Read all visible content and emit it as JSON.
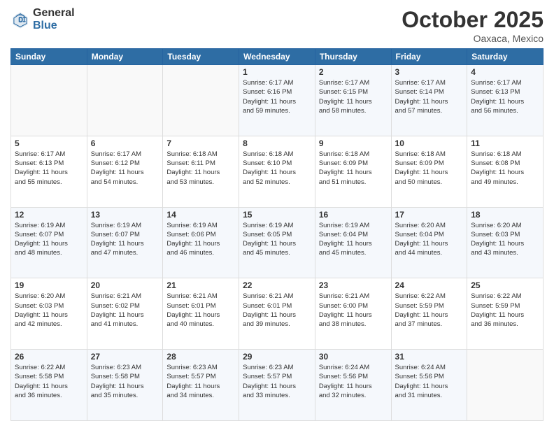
{
  "logo": {
    "general": "General",
    "blue": "Blue"
  },
  "title": "October 2025",
  "location": "Oaxaca, Mexico",
  "days_of_week": [
    "Sunday",
    "Monday",
    "Tuesday",
    "Wednesday",
    "Thursday",
    "Friday",
    "Saturday"
  ],
  "weeks": [
    [
      {
        "day": "",
        "info": ""
      },
      {
        "day": "",
        "info": ""
      },
      {
        "day": "",
        "info": ""
      },
      {
        "day": "1",
        "info": "Sunrise: 6:17 AM\nSunset: 6:16 PM\nDaylight: 11 hours\nand 59 minutes."
      },
      {
        "day": "2",
        "info": "Sunrise: 6:17 AM\nSunset: 6:15 PM\nDaylight: 11 hours\nand 58 minutes."
      },
      {
        "day": "3",
        "info": "Sunrise: 6:17 AM\nSunset: 6:14 PM\nDaylight: 11 hours\nand 57 minutes."
      },
      {
        "day": "4",
        "info": "Sunrise: 6:17 AM\nSunset: 6:13 PM\nDaylight: 11 hours\nand 56 minutes."
      }
    ],
    [
      {
        "day": "5",
        "info": "Sunrise: 6:17 AM\nSunset: 6:13 PM\nDaylight: 11 hours\nand 55 minutes."
      },
      {
        "day": "6",
        "info": "Sunrise: 6:17 AM\nSunset: 6:12 PM\nDaylight: 11 hours\nand 54 minutes."
      },
      {
        "day": "7",
        "info": "Sunrise: 6:18 AM\nSunset: 6:11 PM\nDaylight: 11 hours\nand 53 minutes."
      },
      {
        "day": "8",
        "info": "Sunrise: 6:18 AM\nSunset: 6:10 PM\nDaylight: 11 hours\nand 52 minutes."
      },
      {
        "day": "9",
        "info": "Sunrise: 6:18 AM\nSunset: 6:09 PM\nDaylight: 11 hours\nand 51 minutes."
      },
      {
        "day": "10",
        "info": "Sunrise: 6:18 AM\nSunset: 6:09 PM\nDaylight: 11 hours\nand 50 minutes."
      },
      {
        "day": "11",
        "info": "Sunrise: 6:18 AM\nSunset: 6:08 PM\nDaylight: 11 hours\nand 49 minutes."
      }
    ],
    [
      {
        "day": "12",
        "info": "Sunrise: 6:19 AM\nSunset: 6:07 PM\nDaylight: 11 hours\nand 48 minutes."
      },
      {
        "day": "13",
        "info": "Sunrise: 6:19 AM\nSunset: 6:07 PM\nDaylight: 11 hours\nand 47 minutes."
      },
      {
        "day": "14",
        "info": "Sunrise: 6:19 AM\nSunset: 6:06 PM\nDaylight: 11 hours\nand 46 minutes."
      },
      {
        "day": "15",
        "info": "Sunrise: 6:19 AM\nSunset: 6:05 PM\nDaylight: 11 hours\nand 45 minutes."
      },
      {
        "day": "16",
        "info": "Sunrise: 6:19 AM\nSunset: 6:04 PM\nDaylight: 11 hours\nand 45 minutes."
      },
      {
        "day": "17",
        "info": "Sunrise: 6:20 AM\nSunset: 6:04 PM\nDaylight: 11 hours\nand 44 minutes."
      },
      {
        "day": "18",
        "info": "Sunrise: 6:20 AM\nSunset: 6:03 PM\nDaylight: 11 hours\nand 43 minutes."
      }
    ],
    [
      {
        "day": "19",
        "info": "Sunrise: 6:20 AM\nSunset: 6:03 PM\nDaylight: 11 hours\nand 42 minutes."
      },
      {
        "day": "20",
        "info": "Sunrise: 6:21 AM\nSunset: 6:02 PM\nDaylight: 11 hours\nand 41 minutes."
      },
      {
        "day": "21",
        "info": "Sunrise: 6:21 AM\nSunset: 6:01 PM\nDaylight: 11 hours\nand 40 minutes."
      },
      {
        "day": "22",
        "info": "Sunrise: 6:21 AM\nSunset: 6:01 PM\nDaylight: 11 hours\nand 39 minutes."
      },
      {
        "day": "23",
        "info": "Sunrise: 6:21 AM\nSunset: 6:00 PM\nDaylight: 11 hours\nand 38 minutes."
      },
      {
        "day": "24",
        "info": "Sunrise: 6:22 AM\nSunset: 5:59 PM\nDaylight: 11 hours\nand 37 minutes."
      },
      {
        "day": "25",
        "info": "Sunrise: 6:22 AM\nSunset: 5:59 PM\nDaylight: 11 hours\nand 36 minutes."
      }
    ],
    [
      {
        "day": "26",
        "info": "Sunrise: 6:22 AM\nSunset: 5:58 PM\nDaylight: 11 hours\nand 36 minutes."
      },
      {
        "day": "27",
        "info": "Sunrise: 6:23 AM\nSunset: 5:58 PM\nDaylight: 11 hours\nand 35 minutes."
      },
      {
        "day": "28",
        "info": "Sunrise: 6:23 AM\nSunset: 5:57 PM\nDaylight: 11 hours\nand 34 minutes."
      },
      {
        "day": "29",
        "info": "Sunrise: 6:23 AM\nSunset: 5:57 PM\nDaylight: 11 hours\nand 33 minutes."
      },
      {
        "day": "30",
        "info": "Sunrise: 6:24 AM\nSunset: 5:56 PM\nDaylight: 11 hours\nand 32 minutes."
      },
      {
        "day": "31",
        "info": "Sunrise: 6:24 AM\nSunset: 5:56 PM\nDaylight: 11 hours\nand 31 minutes."
      },
      {
        "day": "",
        "info": ""
      }
    ]
  ]
}
